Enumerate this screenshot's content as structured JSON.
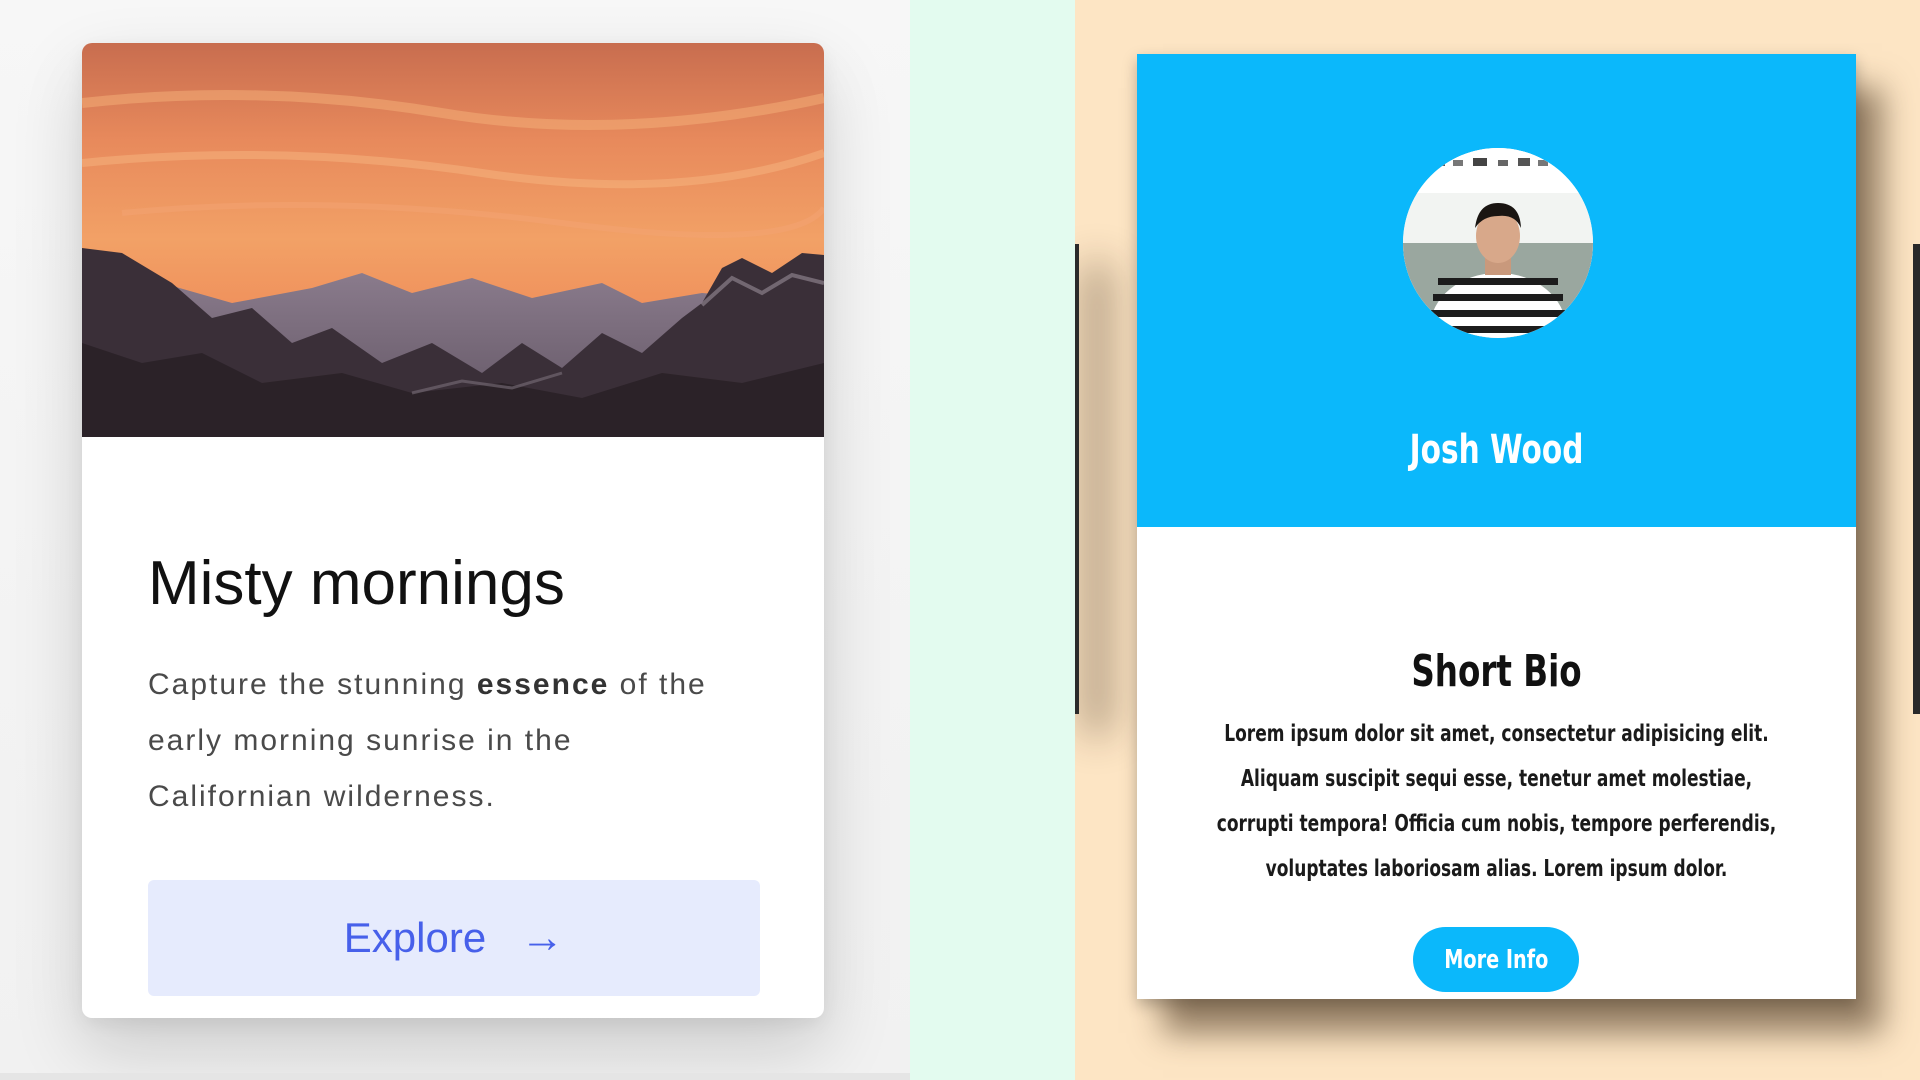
{
  "card_left": {
    "title": "Misty mornings",
    "description_before": "Capture the stunning ",
    "description_bold": "essence",
    "description_after": " of the early morning sunrise in the Californian wilderness.",
    "button_label": "Explore",
    "button_arrow": "→",
    "image_icon": "mountain-sunrise-image",
    "colors": {
      "button_bg": "#e6ebfd",
      "button_text": "#4760ea",
      "panel_bg": "#f3f3f3"
    }
  },
  "card_right": {
    "name": "Josh Wood",
    "bio_title": "Short Bio",
    "bio_text": "Lorem ipsum dolor sit amet, consectetur adipisicing elit. Aliquam suscipit sequi esse, tenetur amet molestiae, corrupti tempora! Officia cum nobis, tempore perferendis, voluptates laboriosam alias. Lorem ipsum dolor.",
    "button_label": "More Info",
    "avatar_icon": "profile-photo",
    "colors": {
      "header_bg": "#0bb8fb",
      "panel_bg": "#fde5c4"
    }
  },
  "middle_strip": {
    "colors": {
      "bg": "#e3fbef"
    }
  }
}
